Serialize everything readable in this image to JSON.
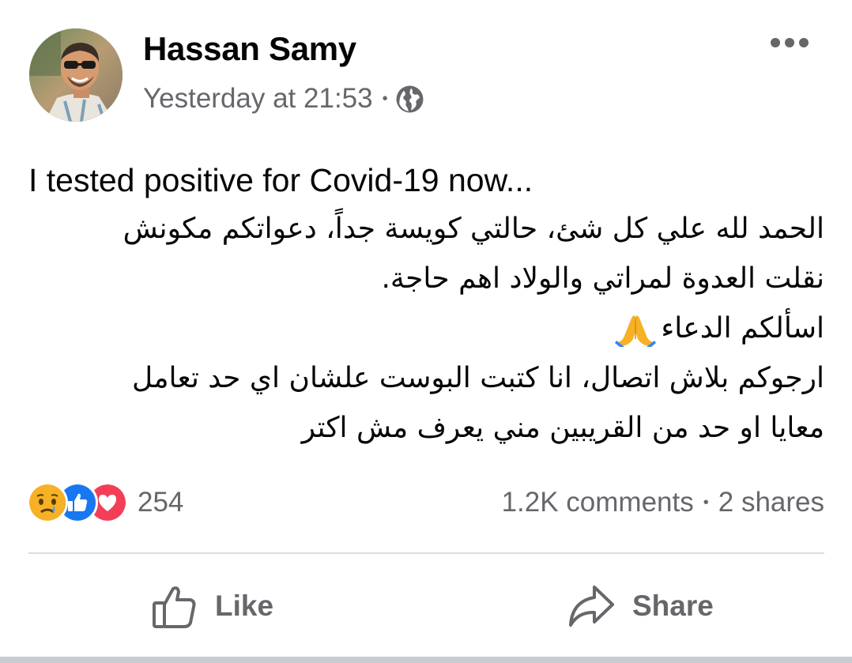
{
  "post": {
    "author": "Hassan Samy",
    "timestamp": "Yesterday at 21:53",
    "separator": "•",
    "audience_icon": "globe-icon",
    "more_icon": "more-options-icon",
    "lines": [
      "I tested positive for Covid-19 now...",
      "الحمد لله علي كل شئ، حالتي كويسة جداً، دعواتكم مكونش",
      "نقلت العدوة لمراتي والولاد اهم حاجة.",
      "اسألكم الدعاء",
      "ارجوكم بلاش اتصال، انا كتبت البوست علشان اي حد تعامل",
      "معايا او حد من القريبين مني يعرف مش اكتر"
    ],
    "emoji_icon": "folded-hands-icon"
  },
  "reactions": {
    "icons": [
      "sad-reaction-icon",
      "like-reaction-icon",
      "love-reaction-icon"
    ],
    "count": "254"
  },
  "stats": {
    "comments": "1.2K comments",
    "separator": "•",
    "shares": "2 shares"
  },
  "actions": {
    "like_label": "Like",
    "share_label": "Share"
  },
  "colors": {
    "text_primary": "#050505",
    "text_secondary": "#65676b",
    "like_blue": "#1877f2",
    "love_red": "#f33e58",
    "sad_yellow": "#f7b125",
    "divider": "#dadde1"
  }
}
